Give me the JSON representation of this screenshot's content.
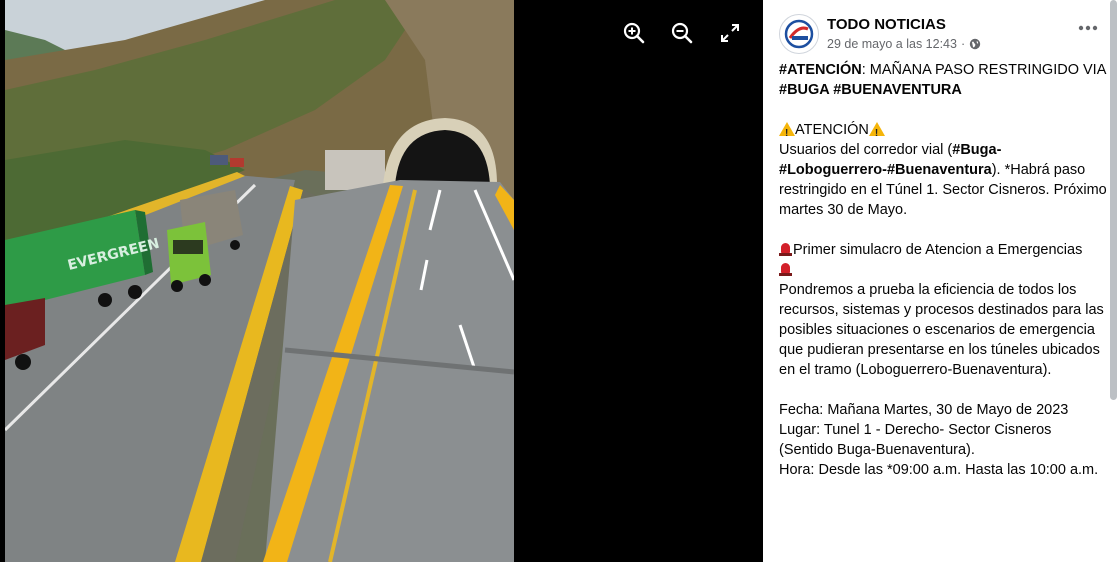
{
  "viewer": {
    "photo_alt": "Highway bridge leading into a tunnel with trucks",
    "tools": [
      {
        "name": "zoom-in-icon"
      },
      {
        "name": "zoom-out-icon"
      },
      {
        "name": "fullscreen-icon"
      }
    ],
    "truck_text": "EVERGREEN"
  },
  "post": {
    "page_name": "TODO NOTICIAS",
    "timestamp": "29 de mayo a las 12:43",
    "separator": "·",
    "icons": {
      "privacy": "globe-icon",
      "more": "more-options-icon"
    },
    "headline_tag1": "#ATENCIÓN",
    "headline_rest": ": MAÑANA PASO RESTRINGIDO VIA",
    "headline_tags2": "#BUGA #BUENAVENTURA",
    "attention": "ATENCIÓN",
    "p1_a": "Usuarios del corredor vial (",
    "p1_tag": "#Buga-#Loboguerrero-#Buenaventura",
    "p1_b": "). *Habrá paso restringido en el Túnel 1. Sector Cisneros. Próximo martes 30 de Mayo.",
    "sim_title": "Primer simulacro de Atencion a Emergencias",
    "p2": "Pondremos a prueba la eficiencia de todos los recursos, sistemas y procesos destinados para las posibles situaciones o escenarios de emergencia que pudieran presentarse en los túneles ubicados en el tramo (Loboguerrero-Buenaventura).",
    "fecha": "Fecha: Mañana Martes, 30 de Mayo de 2023",
    "lugar": "Lugar: Tunel 1 - Derecho- Sector Cisneros (Sentido Buga-Buenaventura).",
    "hora": "Hora: Desde las *09:00 a.m. Hasta las 10:00 a.m."
  },
  "colors": {
    "accent_yellow": "#f2b417",
    "truck_green": "#2e9b47",
    "text_primary": "#050505",
    "text_secondary": "#65676b"
  }
}
